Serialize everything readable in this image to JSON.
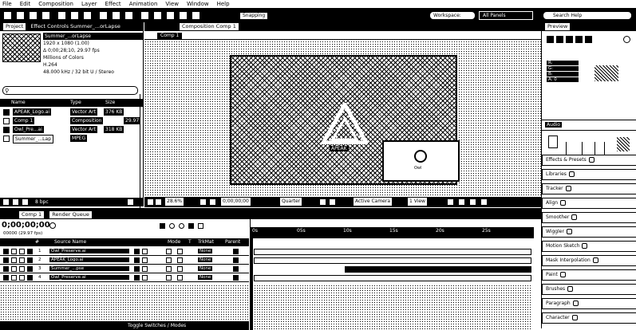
{
  "menu": [
    "File",
    "Edit",
    "Composition",
    "Layer",
    "Effect",
    "Animation",
    "View",
    "Window",
    "Help"
  ],
  "toolbar": {
    "snapping_label": "Snapping",
    "workspace_label": "Workspace:",
    "workspace_value": "All Panels",
    "search_placeholder": "Search Help"
  },
  "project_panel": {
    "tab_label": "Project",
    "effect_controls_tab": "Effect Controls Summer_...orLapse",
    "comp_tab": "Composition Comp 1",
    "item_name": "Summer_...orLapse",
    "item_info": [
      "1920 x 1080 (1.00)",
      "Δ 0;00;28;10, 29.97 fps",
      "Millions of Colors",
      "H.264",
      "48.000 kHz / 32 bit U / Stereo"
    ],
    "columns": [
      "Name",
      "Type",
      "Size"
    ],
    "items": [
      {
        "name": "APEAK_Logo.ai",
        "type": "Vector Art",
        "size": "376 KB"
      },
      {
        "name": "Comp 1",
        "type": "Composition",
        "size": "29.97"
      },
      {
        "name": "Owl_Pre...ai",
        "type": "Vector Art",
        "size": "318 KB"
      },
      {
        "name": "Summer_...Lap",
        "type": "MPEG",
        "size": ""
      }
    ],
    "bpc": "8 bpc"
  },
  "composition": {
    "tab": "Comp 1",
    "zoom": "28.6%",
    "timecode": "0;00;00;00",
    "quality": "Quarter",
    "camera": "Active Camera",
    "views": "1 View",
    "logo_text": "APEAK",
    "owl_label": "Owl"
  },
  "timeline": {
    "tab": "Comp 1",
    "render_queue_tab": "Render Queue",
    "timecode": "0;00;00;00",
    "fps": "00000 (29.97 fps)",
    "columns": [
      "#",
      "Source Name",
      "Mode",
      "T",
      "TrkMat",
      "Parent"
    ],
    "layers": [
      {
        "num": "1",
        "name": "Owl_Preserve.ai",
        "parent": "None"
      },
      {
        "num": "2",
        "name": "APEAK_Logo.ai",
        "parent": "None"
      },
      {
        "num": "3",
        "name": "Summer_...pse",
        "parent": "None"
      },
      {
        "num": "4",
        "name": "Owl_Preserve.ai",
        "parent": "None"
      }
    ],
    "ruler": [
      "0s",
      "05s",
      "10s",
      "15s",
      "20s",
      "25s"
    ],
    "toggle_label": "Toggle Switches / Modes"
  },
  "right_panel": {
    "preview_tab": "Preview",
    "info_values": [
      "R:",
      "G:",
      "B:",
      "A: 0"
    ],
    "audio_tab": "Audio",
    "sections": [
      "Effects & Presets",
      "Libraries",
      "Tracker",
      "Align",
      "Smoother",
      "Wiggler",
      "Motion Sketch",
      "Mask Interpolation",
      "Paint",
      "Brushes",
      "Paragraph",
      "Character"
    ]
  }
}
